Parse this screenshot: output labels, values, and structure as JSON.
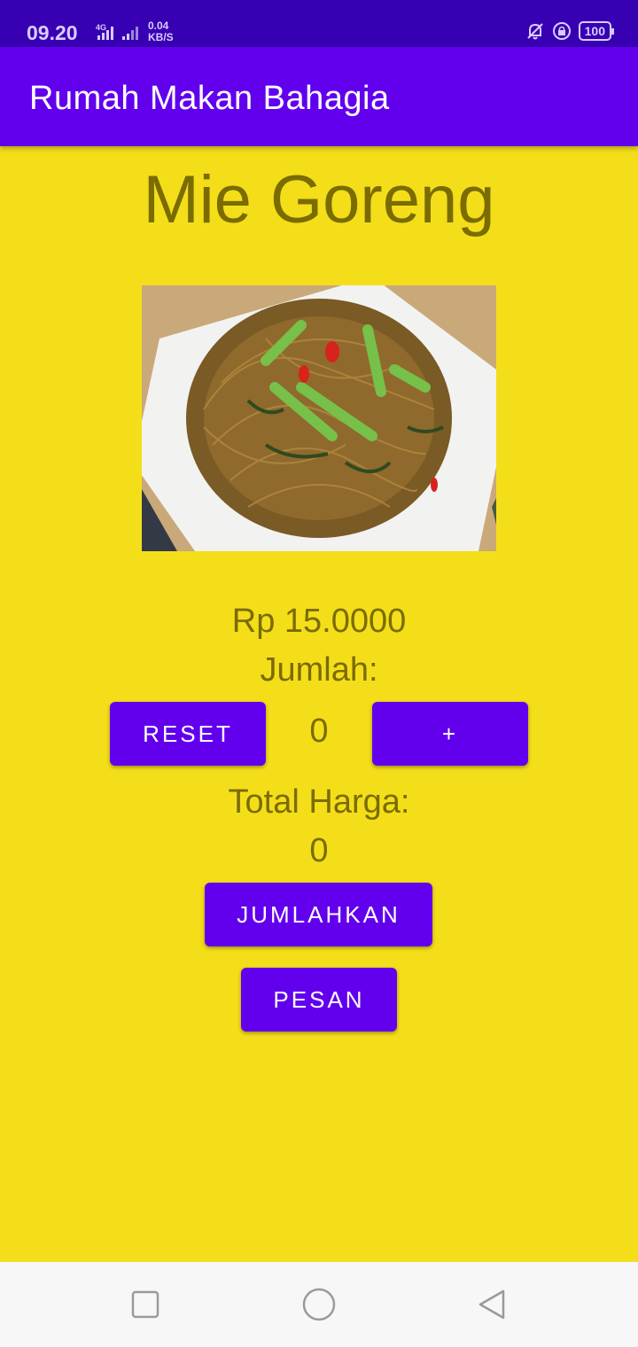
{
  "status_bar": {
    "time": "09.20",
    "network_label": "4G",
    "speed_value": "0.04",
    "speed_unit": "KB/S",
    "battery": "100",
    "icons": [
      "notification-off-icon",
      "screen-lock-icon",
      "battery-icon"
    ]
  },
  "app_bar": {
    "title": "Rumah Makan Bahagia"
  },
  "main": {
    "food_title": "Mie Goreng",
    "price": "Rp 15.0000",
    "quantity_label": "Jumlah:",
    "reset_button": "RESET",
    "quantity_value": "0",
    "plus_button": "+",
    "total_label": "Total Harga:",
    "total_value": "0",
    "sum_button": "JUMLAHKAN",
    "order_button": "PESAN"
  },
  "colors": {
    "status_bar": "#3800b3",
    "app_bar": "#6200ee",
    "background": "#f4de1a",
    "text": "#7a6c00",
    "button": "#6200ee"
  },
  "nav_bar": {
    "icons": [
      "recents-square-icon",
      "home-circle-icon",
      "back-triangle-icon"
    ]
  }
}
